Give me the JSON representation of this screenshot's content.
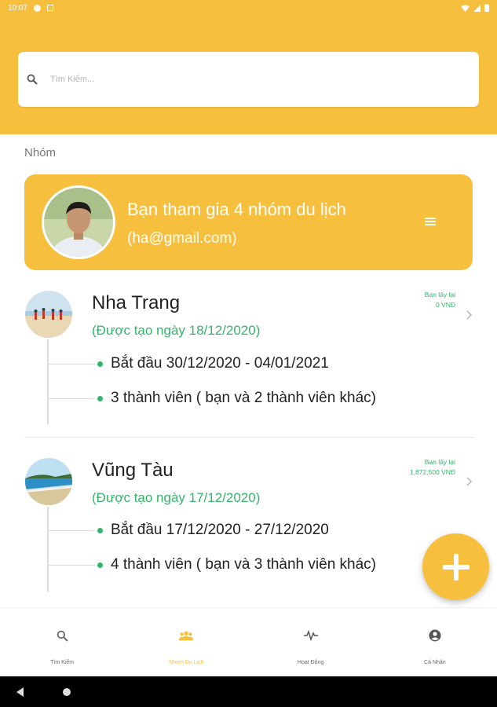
{
  "status_bar": {
    "time": "10:07"
  },
  "search": {
    "placeholder": "Tìm Kiếm..."
  },
  "section": {
    "title": "Nhóm"
  },
  "profile": {
    "title": "Bạn tham gia 4 nhóm du lịch",
    "email": "(ha@gmail.com)"
  },
  "groups": [
    {
      "name": "Nha Trang",
      "created": "(Được tạo ngày 18/12/2020)",
      "dates": "Bắt đầu 30/12/2020 - 04/01/2021",
      "members": "3 thành viên ( bạn và 2 thành viên khác)",
      "owe_label": "Bạn lấy lại",
      "owe_value": "0 VNĐ"
    },
    {
      "name": "Vũng Tàu",
      "created": "(Được tạo ngày 17/12/2020)",
      "dates": "Bắt đầu 17/12/2020 - 27/12/2020",
      "members": "4 thành viên ( bạn và 3 thành viên khác)",
      "owe_label": "Bạn lấy lại",
      "owe_value": "1,872,500 VNĐ"
    }
  ],
  "nav": {
    "items": [
      {
        "label": "Tìm Kiếm",
        "icon": "search-icon"
      },
      {
        "label": "Nhóm Du Lịch",
        "icon": "group-icon"
      },
      {
        "label": "Hoạt Động",
        "icon": "activity-icon"
      },
      {
        "label": "Cá Nhân",
        "icon": "account-icon"
      }
    ],
    "active": 1
  },
  "colors": {
    "accent": "#f7bf3e",
    "green": "#35b36a"
  }
}
